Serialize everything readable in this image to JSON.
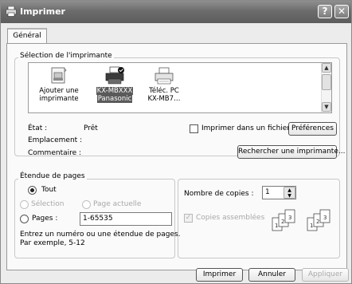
{
  "window": {
    "title": "Imprimer",
    "help_glyph": "?",
    "close_glyph": "✕"
  },
  "tabs": [
    {
      "label": "Général"
    }
  ],
  "printer_selection": {
    "legend": "Sélection de l'imprimante",
    "printers": [
      {
        "line1": "Ajouter une",
        "line2": "imprimante",
        "icon": "add-printer-icon",
        "selected": false
      },
      {
        "line1": "KX-MBXXX",
        "line2": "Panasonic",
        "icon": "printer-default-icon",
        "selected": true
      },
      {
        "line1": "Téléc. PC",
        "line2": "KX-MB7…",
        "icon": "fax-printer-icon",
        "selected": false
      }
    ]
  },
  "status": {
    "etat_label": "État :",
    "etat_value": "Prêt",
    "emplacement_label": "Emplacement :",
    "commentaire_label": "Commentaire :",
    "print_to_file_label": "Imprimer dans un fichier",
    "preferences_button": "Préférences",
    "find_printer_button": "Rechercher une imprimante..."
  },
  "page_range": {
    "legend": "Étendue de pages",
    "all_label": "Tout",
    "selection_label": "Sélection",
    "current_page_label": "Page actuelle",
    "pages_label": "Pages :",
    "pages_value": "1-65535",
    "hint_line1": "Entrez un numéro ou une étendue de pages.",
    "hint_line2": "Par exemple, 5-12"
  },
  "copies": {
    "label": "Nombre de copies :",
    "value": "1",
    "collate_label": "Copies assemblées"
  },
  "footer": {
    "print_button": "Imprimer",
    "cancel_button": "Annuler",
    "apply_button": "Appliquer"
  }
}
